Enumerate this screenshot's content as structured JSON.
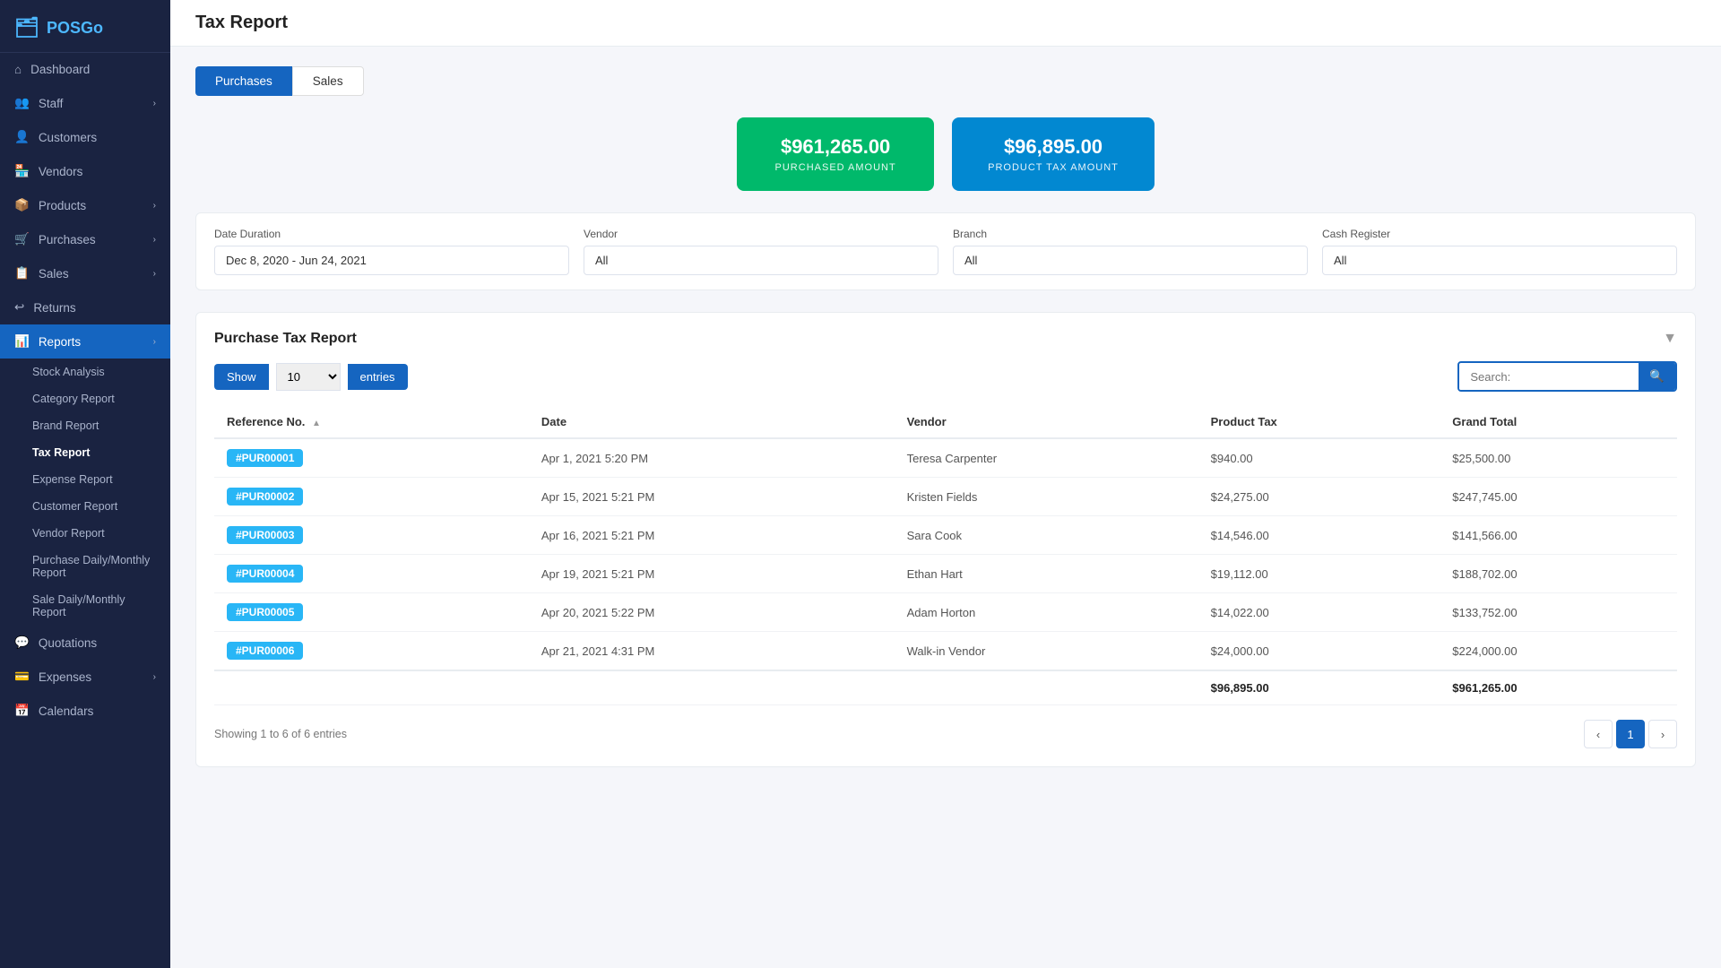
{
  "app": {
    "name": "POSGo",
    "logo_icon": "🗂"
  },
  "sidebar": {
    "items": [
      {
        "id": "dashboard",
        "label": "Dashboard",
        "icon": "⌂",
        "active": false,
        "hasChildren": false
      },
      {
        "id": "staff",
        "label": "Staff",
        "icon": "👥",
        "active": false,
        "hasChildren": true
      },
      {
        "id": "customers",
        "label": "Customers",
        "icon": "👤",
        "active": false,
        "hasChildren": false
      },
      {
        "id": "vendors",
        "label": "Vendors",
        "icon": "🏪",
        "active": false,
        "hasChildren": false
      },
      {
        "id": "products",
        "label": "Products",
        "icon": "📦",
        "active": false,
        "hasChildren": true
      },
      {
        "id": "purchases",
        "label": "Purchases",
        "icon": "🛒",
        "active": false,
        "hasChildren": true
      },
      {
        "id": "sales",
        "label": "Sales",
        "icon": "📋",
        "active": false,
        "hasChildren": true
      },
      {
        "id": "returns",
        "label": "Returns",
        "icon": "↩",
        "active": false,
        "hasChildren": false
      },
      {
        "id": "reports",
        "label": "Reports",
        "icon": "📊",
        "active": true,
        "hasChildren": true
      }
    ],
    "sub_items": [
      {
        "id": "stock-analysis",
        "label": "Stock Analysis",
        "active": false
      },
      {
        "id": "category-report",
        "label": "Category Report",
        "active": false
      },
      {
        "id": "brand-report",
        "label": "Brand Report",
        "active": false
      },
      {
        "id": "tax-report",
        "label": "Tax Report",
        "active": true
      },
      {
        "id": "expense-report",
        "label": "Expense Report",
        "active": false
      },
      {
        "id": "customer-report",
        "label": "Customer Report",
        "active": false
      },
      {
        "id": "vendor-report",
        "label": "Vendor Report",
        "active": false
      },
      {
        "id": "purchase-daily",
        "label": "Purchase Daily/Monthly Report",
        "active": false
      },
      {
        "id": "sale-daily",
        "label": "Sale Daily/Monthly Report",
        "active": false
      }
    ],
    "bottom_items": [
      {
        "id": "quotations",
        "label": "Quotations",
        "icon": "💬",
        "hasChildren": false
      },
      {
        "id": "expenses",
        "label": "Expenses",
        "icon": "💳",
        "hasChildren": true
      },
      {
        "id": "calendars",
        "label": "Calendars",
        "icon": "📅",
        "hasChildren": false
      }
    ]
  },
  "page": {
    "title": "Tax Report"
  },
  "tabs": [
    {
      "id": "purchases",
      "label": "Purchases",
      "active": true
    },
    {
      "id": "sales",
      "label": "Sales",
      "active": false
    }
  ],
  "summary_cards": [
    {
      "id": "purchased-amount",
      "amount": "$961,265.00",
      "label": "PURCHASED AMOUNT",
      "color": "green"
    },
    {
      "id": "product-tax-amount",
      "amount": "$96,895.00",
      "label": "PRODUCT TAX AMOUNT",
      "color": "blue"
    }
  ],
  "filters": {
    "date_duration": {
      "label": "Date Duration",
      "value": "Dec 8, 2020 - Jun 24, 2021",
      "placeholder": "Dec 8, 2020 - Jun 24, 2021"
    },
    "vendor": {
      "label": "Vendor",
      "value": "All",
      "placeholder": "All"
    },
    "branch": {
      "label": "Branch",
      "value": "All",
      "placeholder": "All"
    },
    "cash_register": {
      "label": "Cash Register",
      "value": "All",
      "placeholder": "All"
    }
  },
  "report_section": {
    "title": "Purchase Tax Report",
    "show_entries": {
      "show_label": "Show",
      "value": "10",
      "entries_label": "entries"
    },
    "search_placeholder": "Search:",
    "table": {
      "columns": [
        {
          "id": "ref_no",
          "label": "Reference No.",
          "sortable": true
        },
        {
          "id": "date",
          "label": "Date",
          "sortable": false
        },
        {
          "id": "vendor",
          "label": "Vendor",
          "sortable": false
        },
        {
          "id": "product_tax",
          "label": "Product Tax",
          "sortable": false
        },
        {
          "id": "grand_total",
          "label": "Grand Total",
          "sortable": false
        }
      ],
      "rows": [
        {
          "ref_no": "#PUR00001",
          "date": "Apr 1, 2021 5:20 PM",
          "vendor": "Teresa Carpenter",
          "product_tax": "$940.00",
          "grand_total": "$25,500.00"
        },
        {
          "ref_no": "#PUR00002",
          "date": "Apr 15, 2021 5:21 PM",
          "vendor": "Kristen Fields",
          "product_tax": "$24,275.00",
          "grand_total": "$247,745.00"
        },
        {
          "ref_no": "#PUR00003",
          "date": "Apr 16, 2021 5:21 PM",
          "vendor": "Sara Cook",
          "product_tax": "$14,546.00",
          "grand_total": "$141,566.00"
        },
        {
          "ref_no": "#PUR00004",
          "date": "Apr 19, 2021 5:21 PM",
          "vendor": "Ethan Hart",
          "product_tax": "$19,112.00",
          "grand_total": "$188,702.00"
        },
        {
          "ref_no": "#PUR00005",
          "date": "Apr 20, 2021 5:22 PM",
          "vendor": "Adam Horton",
          "product_tax": "$14,022.00",
          "grand_total": "$133,752.00"
        },
        {
          "ref_no": "#PUR00006",
          "date": "Apr 21, 2021 4:31 PM",
          "vendor": "Walk-in Vendor",
          "product_tax": "$24,000.00",
          "grand_total": "$224,000.00"
        }
      ],
      "totals": {
        "product_tax": "$96,895.00",
        "grand_total": "$961,265.00"
      }
    },
    "pagination": {
      "showing_text": "Showing 1 to 6 of 6 entries",
      "current_page": 1,
      "total_pages": 1
    }
  }
}
